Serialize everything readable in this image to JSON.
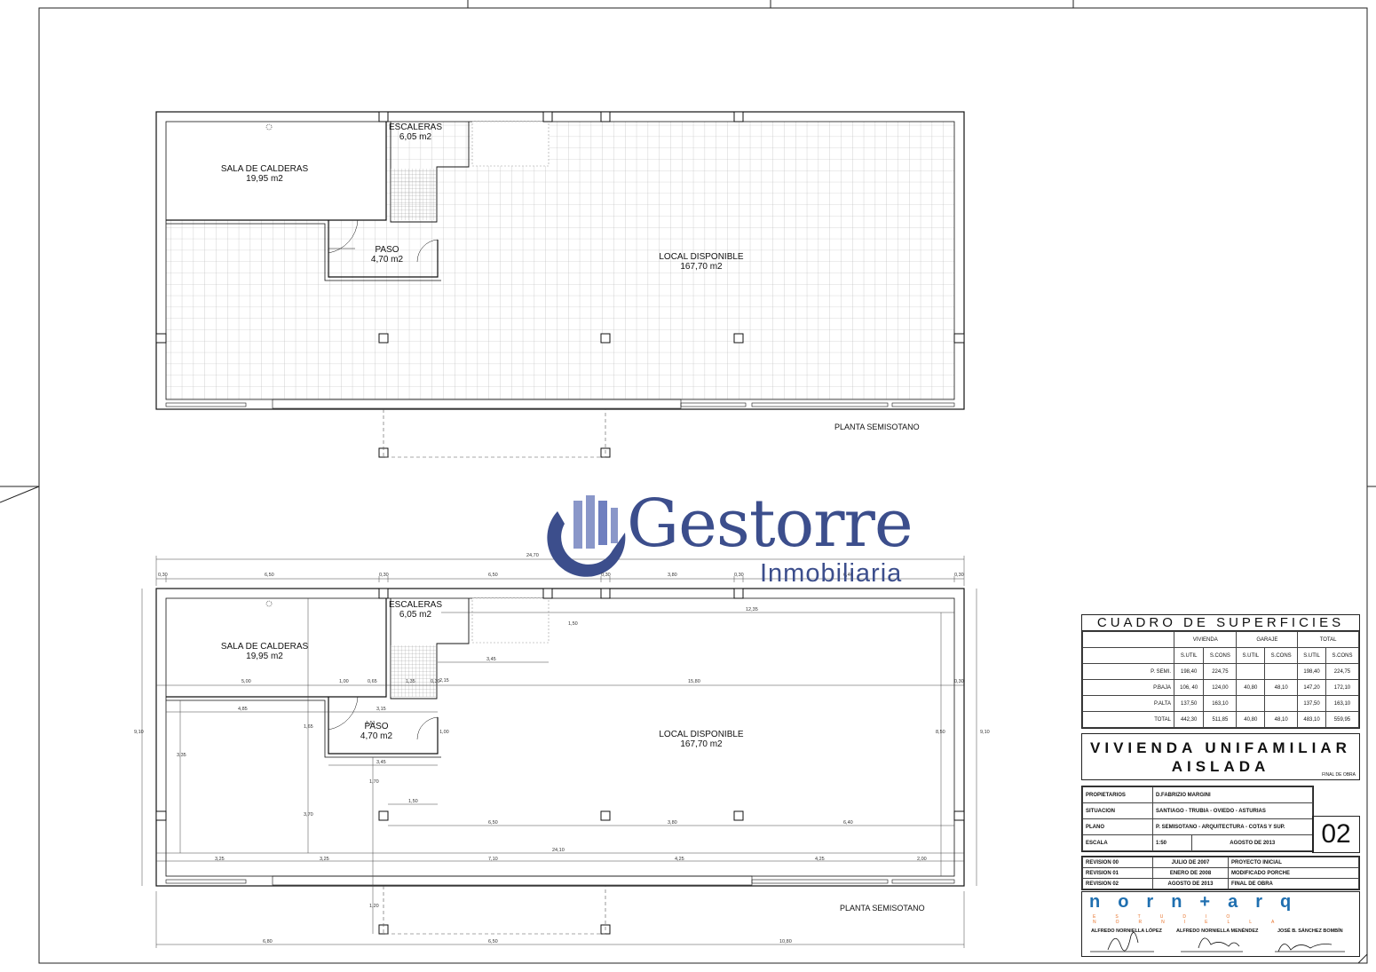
{
  "plan_top": {
    "rooms": [
      {
        "name": "SALA DE CALDERAS",
        "area": "19,95 m2"
      },
      {
        "name": "ESCALERAS",
        "area": "6,05 m2"
      },
      {
        "name": "PASO",
        "area": "4,70 m2"
      },
      {
        "name": "LOCAL DISPONIBLE",
        "area": "167,70 m2"
      }
    ],
    "caption": "PLANTA SEMISOTANO"
  },
  "plan_bottom": {
    "rooms": [
      {
        "name": "SALA DE CALDERAS",
        "area": "19,95 m2"
      },
      {
        "name": "ESCALERAS",
        "area": "6,05 m2"
      },
      {
        "name": "PASO",
        "area": "4,70 m2"
      },
      {
        "name": "LOCAL DISPONIBLE",
        "area": "167,70 m2"
      }
    ],
    "caption": "PLANTA SEMISOTANO",
    "dimensions": {
      "overall": "24,70",
      "top_row": [
        "0,30",
        "6,50",
        "0,30",
        "6,50",
        "0,30",
        "3,80",
        "0,30",
        "6,40",
        "0,30"
      ],
      "inner_a": [
        "5,00",
        "1,00",
        "0,65",
        "1,35",
        "0,30",
        "15,80",
        "0,30"
      ],
      "inner_b": [
        "4,85",
        "3,15",
        "3,45",
        "1,50",
        "3,45",
        "1,50"
      ],
      "overall_inner": "24,10",
      "bottom_row": [
        "3,25",
        "3,25",
        "7,10",
        "4,25",
        "4,25",
        "2,00"
      ],
      "porch_row": [
        "6,80",
        "6,50",
        "10,80"
      ],
      "misc": [
        "12,35",
        "1,50",
        "6,50",
        "3,80",
        "6,40",
        "8,50",
        "9,10",
        "3,35",
        "3,70",
        "1,70",
        "1,20",
        "1,65",
        "1,51",
        "1,00",
        "2,15"
      ]
    }
  },
  "watermark": {
    "name": "Gestorre",
    "sub": "Inmobiliaria"
  },
  "surfaces": {
    "title": "CUADRO DE SUPERFICIES",
    "groups": [
      "VIVIENDA",
      "GARAJE",
      "TOTAL"
    ],
    "cols": [
      "S.UTIL",
      "S.CONS",
      "S.UTIL",
      "S.CONS",
      "S.UTIL",
      "S.CONS"
    ],
    "rows": [
      {
        "label": "P. SEMI.",
        "vals": [
          "198,40",
          "224,75",
          "",
          "",
          "198,40",
          "224,75"
        ]
      },
      {
        "label": "P.BAJA",
        "vals": [
          "106, 40",
          "124,00",
          "40,80",
          "48,10",
          "147,20",
          "172,10"
        ]
      },
      {
        "label": "P.ALTA",
        "vals": [
          "137,50",
          "163,10",
          "",
          "",
          "137,50",
          "163,10"
        ]
      },
      {
        "label": "TOTAL",
        "vals": [
          "442,30",
          "511,85",
          "40,80",
          "48,10",
          "483,10",
          "559,95"
        ]
      }
    ]
  },
  "project": {
    "title1": "VIVIENDA UNIFAMILIAR",
    "title2": "AISLADA",
    "stage": "FINAL DE OBRA"
  },
  "info": {
    "propietarios_k": "PROPIETARIOS",
    "propietarios_v": "D.FABRIZIO MARGINI",
    "situacion_k": "SITUACION",
    "situacion_v": "SANTIAGO - TRUBIA - OVIEDO - ASTURIAS",
    "plano_k": "PLANO",
    "plano_v": "P. SEMISOTANO - ARQUITECTURA - COTAS Y SUP.",
    "escala_k": "ESCALA",
    "escala_v": "1:50",
    "fecha": "AGOSTO DE 2013",
    "sheet": "02"
  },
  "revisions": [
    {
      "rev": "REVISION 00",
      "date": "JULIO DE 2007",
      "desc": "PROYECTO INICIAL"
    },
    {
      "rev": "REVISION 01",
      "date": "ENERO DE 2008",
      "desc": "MODIFICADO PORCHE"
    },
    {
      "rev": "REVISION 02",
      "date": "AGOSTO DE 2013",
      "desc": "FINAL DE OBRA"
    }
  ],
  "firm": {
    "logo": "norn+arq",
    "sub": "ESTUDIO NORNIELLA",
    "architects": [
      "ALFREDO NORNIELLA LÓPEZ",
      "ALFREDO NORNIELLA MENÉNDEZ",
      "JOSÉ B. SÁNCHEZ BOMBÍN"
    ]
  }
}
